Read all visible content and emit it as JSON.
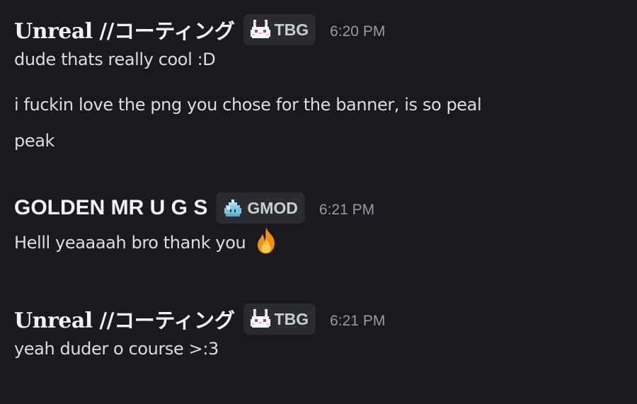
{
  "messages": [
    {
      "author": {
        "name_styled": "Unreal",
        "name_rest": " //コーティング",
        "tag": "TBG",
        "tag_icon": "bunny-icon"
      },
      "timestamp": "6:20 PM",
      "lines": [
        "dude thats really cool :D",
        "i fuckin love the png you chose for the banner, is so peal",
        "peak"
      ]
    },
    {
      "author": {
        "name": "GOLDEN MR U G S",
        "tag": "GMOD",
        "tag_icon": "blue-slime-icon"
      },
      "timestamp": "6:21 PM",
      "lines": [
        "Helll yeaaaah bro thank you"
      ],
      "emoji": "fire-emoji"
    },
    {
      "author": {
        "name_styled": "Unreal",
        "name_rest": " //コーティング",
        "tag": "TBG",
        "tag_icon": "bunny-icon"
      },
      "timestamp": "6:21 PM",
      "lines": [
        "yeah duder o course >:3"
      ]
    }
  ],
  "colors": {
    "background": "#1a1a1e",
    "text": "#dbdee1",
    "username": "#f2f3f5",
    "timestamp": "#949ba4",
    "tag_bg": "#2b2c31"
  }
}
